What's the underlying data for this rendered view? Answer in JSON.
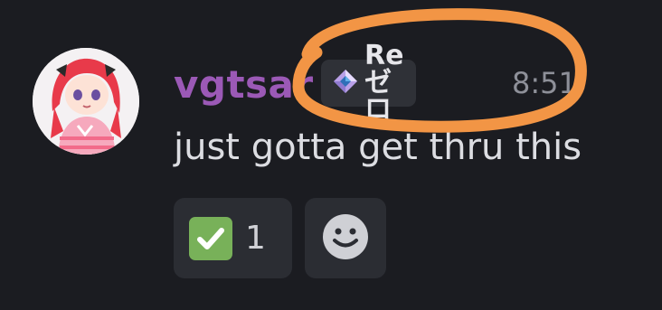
{
  "message": {
    "author": "vgtsar",
    "clan_tag": "Reゼロ",
    "timestamp": "8:51",
    "content": "just gotta get thru this"
  },
  "reactions": [
    {
      "emoji": "check-mark-button",
      "count": "1"
    },
    {
      "emoji": "add-reaction-smiley"
    }
  ],
  "colors": {
    "background": "#1b1c21",
    "username": "#9b59b6",
    "clan_tag_bg": "#2f3137",
    "reaction_bg": "#2b2d33",
    "check_green": "#78b159",
    "annotation": "#f29545"
  }
}
